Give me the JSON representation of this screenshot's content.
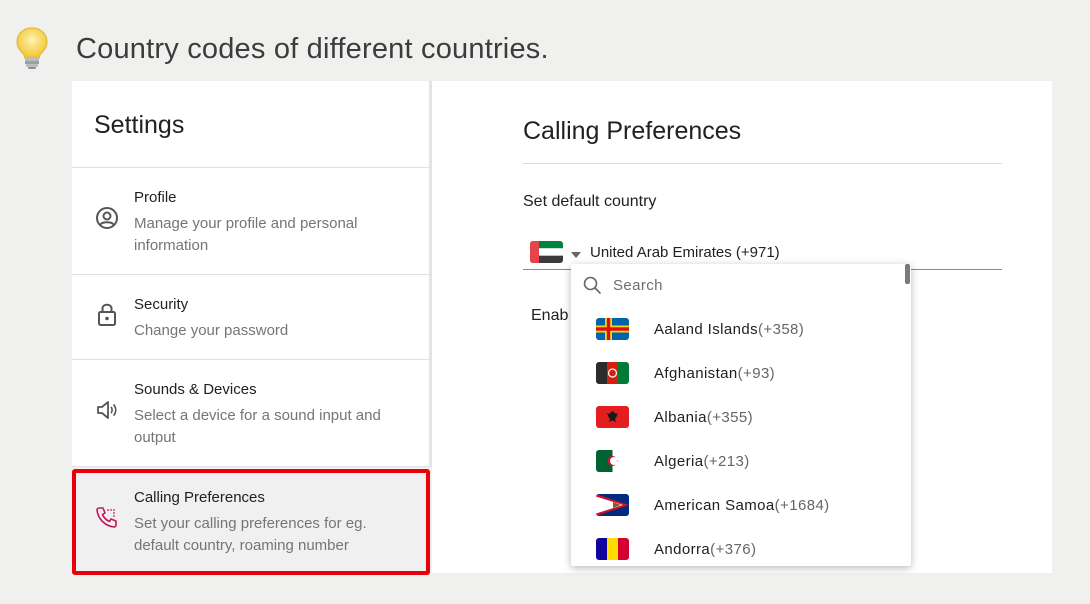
{
  "banner": {
    "title": "Country codes of different countries.",
    "icon": "lightbulb-icon"
  },
  "sidebar": {
    "title": "Settings",
    "items": [
      {
        "label": "Profile",
        "desc": "Manage your profile and personal information",
        "icon": "profile-icon"
      },
      {
        "label": "Security",
        "desc": "Change your password",
        "icon": "lock-icon"
      },
      {
        "label": "Sounds & Devices",
        "desc": "Select a device for a sound input and output",
        "icon": "speaker-icon"
      },
      {
        "label": "Calling Preferences",
        "desc": "Set your calling preferences for eg. default country, roaming number",
        "icon": "phone-icon",
        "active": true
      }
    ]
  },
  "main": {
    "title": "Calling Preferences",
    "default_country_label": "Set default country",
    "selected_country": "United Arab Emirates  (+971)",
    "partial_label": "Enab"
  },
  "dropdown": {
    "search_placeholder": "Search",
    "options": [
      {
        "name": "Aaland Islands",
        "code": "(+358)",
        "flag": "aland-flag"
      },
      {
        "name": "Afghanistan",
        "code": "(+93)",
        "flag": "afghanistan-flag"
      },
      {
        "name": "Albania",
        "code": "(+355)",
        "flag": "albania-flag"
      },
      {
        "name": "Algeria",
        "code": "(+213)",
        "flag": "algeria-flag"
      },
      {
        "name": "American Samoa",
        "code": "(+1684)",
        "flag": "american-samoa-flag"
      },
      {
        "name": "Andorra",
        "code": "(+376)",
        "flag": "andorra-flag"
      }
    ]
  },
  "colors": {
    "highlight": "#e8000b",
    "active_bg": "#f0f0f0",
    "phone_icon": "#c2185b"
  }
}
